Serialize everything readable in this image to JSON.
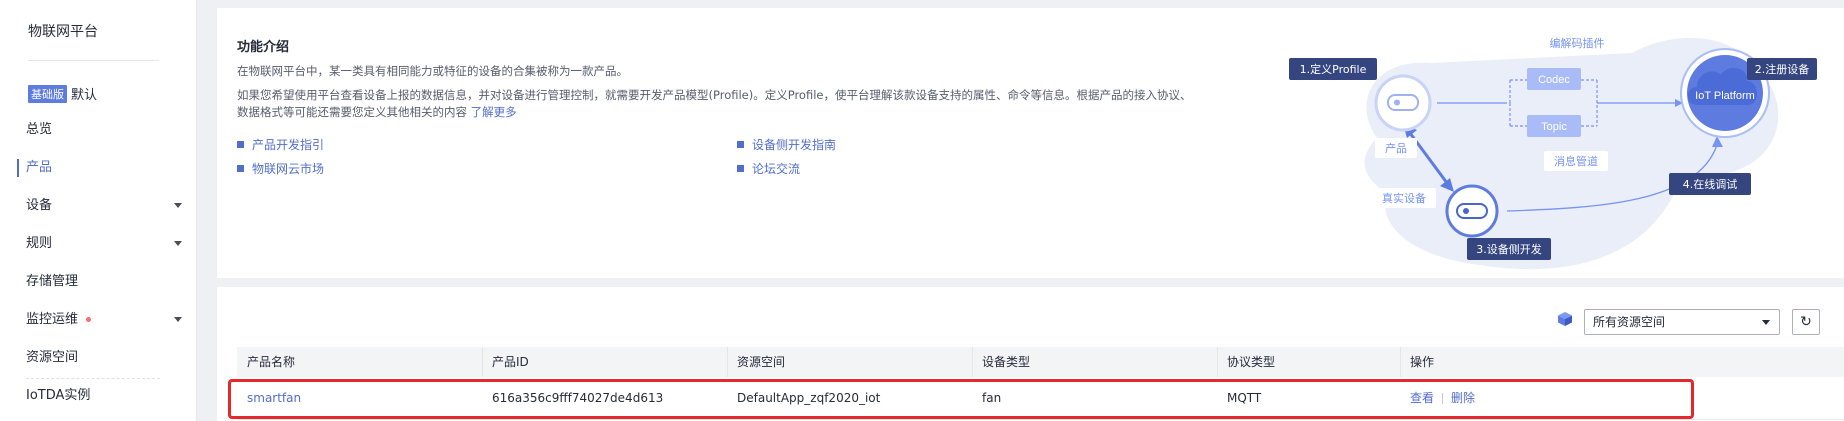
{
  "sidebar": {
    "title": "物联网平台",
    "edition_badge": "基础版",
    "edition_label": "默认",
    "items": [
      {
        "label": "总览"
      },
      {
        "label": "产品"
      },
      {
        "label": "设备"
      },
      {
        "label": "规则"
      },
      {
        "label": "存储管理"
      },
      {
        "label": "监控运维"
      },
      {
        "label": "资源空间"
      },
      {
        "label": "IoTDA实例"
      }
    ]
  },
  "intro": {
    "title": "功能介绍",
    "p1": "在物联网平台中，某一类具有相同能力或特征的设备的合集被称为一款产品。",
    "p2_line1": "如果您希望使用平台查看设备上报的数据信息，并对设备进行管理控制，就需要开发产品模型(Profile)。定义Profile，使平台理解该款设备支持的属性、命令等信息。根据产品的接入协议、",
    "p2_line2": "数据格式等可能还需要您定义其他相关的内容",
    "learn_more": "了解更多",
    "links": [
      "产品开发指引",
      "设备侧开发指南",
      "物联网云市场",
      "论坛交流"
    ]
  },
  "diagram": {
    "step1": "1.定义Profile",
    "step2": "2.注册设备",
    "step3": "3.设备侧开发",
    "step4": "4.在线调试",
    "codec_plugin": "编解码插件",
    "codec": "Codec",
    "topic": "Topic",
    "message_pipe": "消息管道",
    "product": "产品",
    "real_device": "真实设备",
    "platform": "IoT Platform"
  },
  "filter": {
    "resource_space": "所有资源空间"
  },
  "table": {
    "headers": [
      "产品名称",
      "产品ID",
      "资源空间",
      "设备类型",
      "协议类型",
      "操作"
    ],
    "rows": [
      {
        "name": "smartfan",
        "id": "616a356c9fff74027de4d613",
        "space": "DefaultApp_zqf2020_iot",
        "device_type": "fan",
        "protocol": "MQTT",
        "action_view": "查看",
        "action_delete": "删除"
      }
    ]
  },
  "colors": {
    "accent": "#526ecc",
    "highlight_border": "#e5282b",
    "step_label_bg": "#344580"
  }
}
